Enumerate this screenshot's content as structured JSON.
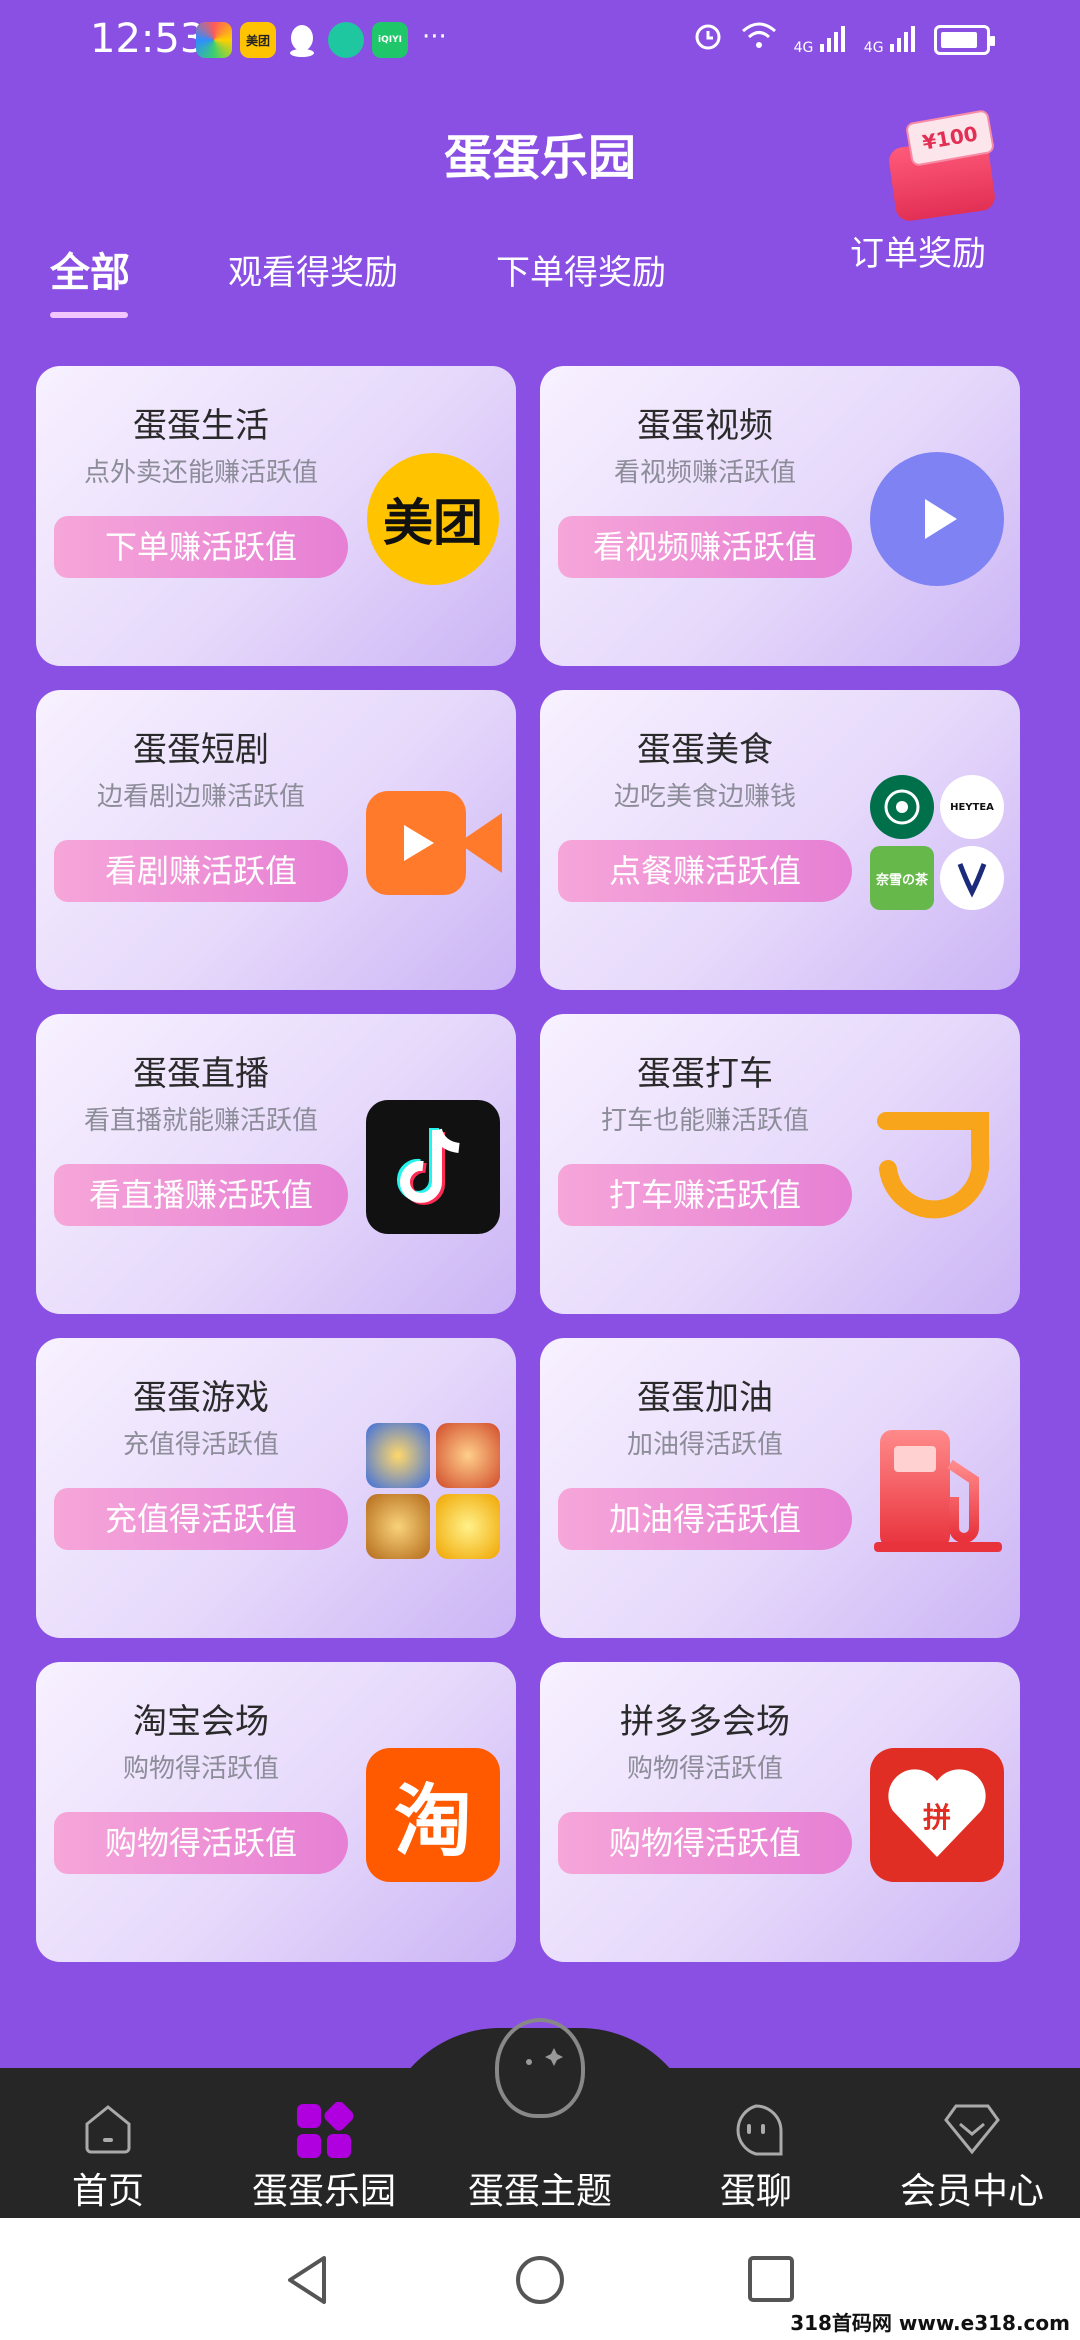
{
  "status_bar": {
    "time": "12:53",
    "apps": [
      {
        "icon": "browser-icon",
        "label": "",
        "color": "#4ac3f0"
      },
      {
        "icon": "meituan-app-icon",
        "label": "美团",
        "color": "#ffc300"
      },
      {
        "icon": "qq-icon",
        "label": "",
        "color": "#ffffff"
      },
      {
        "icon": "app-icon",
        "label": "",
        "color": "#1fc7a0"
      },
      {
        "icon": "iqiyi-icon",
        "label": "iQIYI",
        "color": "#1fc76a"
      }
    ],
    "more": "···",
    "network_1": "4G",
    "network_2": "4G"
  },
  "header": {
    "title": "蛋蛋乐园",
    "tabs": [
      {
        "label": "全部",
        "active": true
      },
      {
        "label": "观看得奖励",
        "active": false
      },
      {
        "label": "下单得奖励",
        "active": false
      }
    ],
    "order_reward": {
      "ticket": "¥100",
      "label": "订单奖励"
    }
  },
  "cards": [
    {
      "title": "蛋蛋生活",
      "subtitle": "点外卖还能赚活跃值",
      "button": "下单赚活跃值",
      "icon": "meituan-logo-icon",
      "logo_text": "美团"
    },
    {
      "title": "蛋蛋视频",
      "subtitle": "看视频赚活跃值",
      "button": "看视频赚活跃值",
      "icon": "play-icon"
    },
    {
      "title": "蛋蛋短剧",
      "subtitle": "边看剧边赚活跃值",
      "button": "看剧赚活跃值",
      "icon": "video-camera-icon"
    },
    {
      "title": "蛋蛋美食",
      "subtitle": "边吃美食边赚钱",
      "button": "点餐赚活跃值",
      "icon": "food-brands-icon",
      "brands": [
        {
          "text": "",
          "color": "#00704a"
        },
        {
          "text": "HEYTEA",
          "color": "#ffffff"
        },
        {
          "text": "奈雪の茶",
          "color": "#67b84a"
        },
        {
          "text": "",
          "color": "#ffffff"
        }
      ]
    },
    {
      "title": "蛋蛋直播",
      "subtitle": "看直播就能赚活跃值",
      "button": "看直播赚活跃值",
      "icon": "tiktok-icon"
    },
    {
      "title": "蛋蛋打车",
      "subtitle": "打车也能赚活跃值",
      "button": "打车赚活跃值",
      "icon": "didi-icon"
    },
    {
      "title": "蛋蛋游戏",
      "subtitle": "充值得活跃值",
      "button": "充值得活跃值",
      "icon": "games-icon"
    },
    {
      "title": "蛋蛋加油",
      "subtitle": "加油得活跃值",
      "button": "加油得活跃值",
      "icon": "fuel-pump-icon"
    },
    {
      "title": "淘宝会场",
      "subtitle": "购物得活跃值",
      "button": "购物得活跃值",
      "icon": "taobao-icon",
      "logo_text": "淘"
    },
    {
      "title": "拼多多会场",
      "subtitle": "购物得活跃值",
      "button": "购物得活跃值",
      "icon": "pinduoduo-icon",
      "logo_text": "拼"
    }
  ],
  "bottom_nav": [
    {
      "label": "首页",
      "icon": "home-icon",
      "active": false
    },
    {
      "label": "蛋蛋乐园",
      "icon": "apps-grid-icon",
      "active": true
    },
    {
      "label": "蛋蛋主题",
      "icon": "egg-icon",
      "active": false
    },
    {
      "label": "蛋聊",
      "icon": "chat-face-icon",
      "active": false
    },
    {
      "label": "会员中心",
      "icon": "diamond-icon",
      "active": false
    }
  ],
  "watermark": "318首码网 www.e318.com",
  "colors": {
    "background": "#8a4fe3",
    "button_gradient_start": "#f6a6d9",
    "button_gradient_end": "#e67fd4",
    "nav_background": "#262626",
    "active_nav": "#b000e0"
  }
}
